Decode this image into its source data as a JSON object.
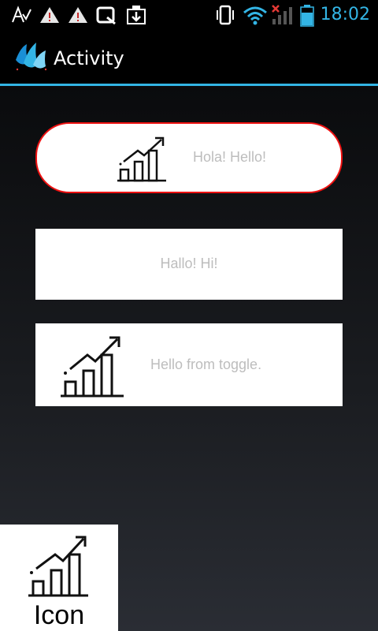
{
  "status_bar": {
    "time": "18:02",
    "icons": [
      "spellcheck-icon",
      "warning-icon",
      "warning-icon",
      "q-app-icon",
      "download-icon",
      "vibrate-icon",
      "wifi-icon",
      "signal-no-service-icon",
      "battery-icon"
    ]
  },
  "action_bar": {
    "title": "Activity",
    "logo_icon": "app-logo-icon"
  },
  "buttons": {
    "pill_label": "Hola! Hello!",
    "rect_label": "Hallo! Hi!",
    "toggle_label": "Hello from toggle."
  },
  "icon_tile": {
    "label": "Icon",
    "icon": "growth-chart-icon"
  },
  "colors": {
    "accent": "#33b5e5",
    "pill_border": "#ee1111",
    "label_gray": "#bdbdbd"
  }
}
